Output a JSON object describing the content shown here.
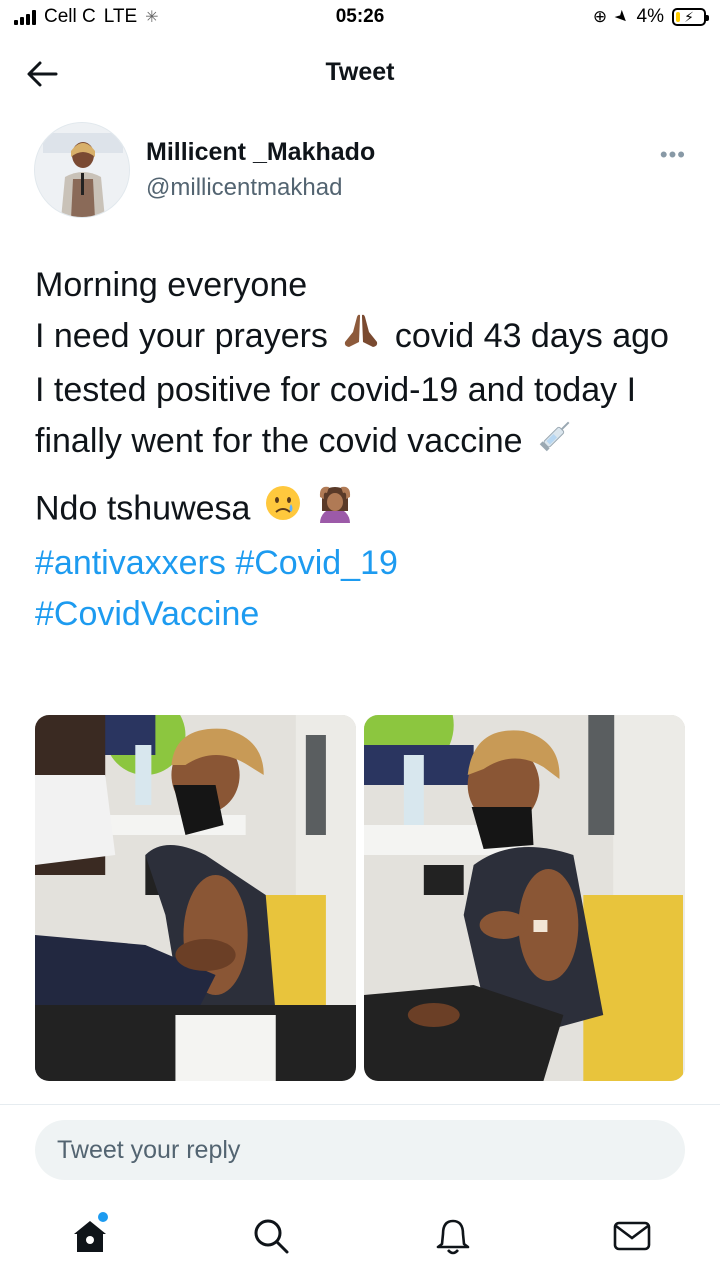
{
  "status_bar": {
    "carrier": "Cell C",
    "network": "LTE",
    "time": "05:26",
    "battery": "4%",
    "battery_level": 0.04
  },
  "header": {
    "title": "Tweet"
  },
  "tweet": {
    "author_name": "Millicent _Makhado",
    "author_handle": "@millicentmakhad",
    "line1": "Morning everyone",
    "line2a": "I need your prayers",
    "line2b": "covid 43 days ago I tested positive for covid-19 and today I finally went for the covid vaccine",
    "line3": "Ndo tshuwesa",
    "hashtags": [
      "#antivaxxers",
      "#Covid_19",
      "#CovidVaccine"
    ],
    "emoji": [
      "praying-hands",
      "syringe",
      "crying-face",
      "woman-gesturing-ok"
    ]
  },
  "reply": {
    "placeholder": "Tweet your reply"
  },
  "tabbar": {
    "items": [
      "home-icon",
      "search-icon",
      "notifications-icon",
      "messages-icon"
    ]
  },
  "colors": {
    "accent": "#1d9bf0",
    "text": "#0f1419",
    "secondary": "#536471"
  }
}
